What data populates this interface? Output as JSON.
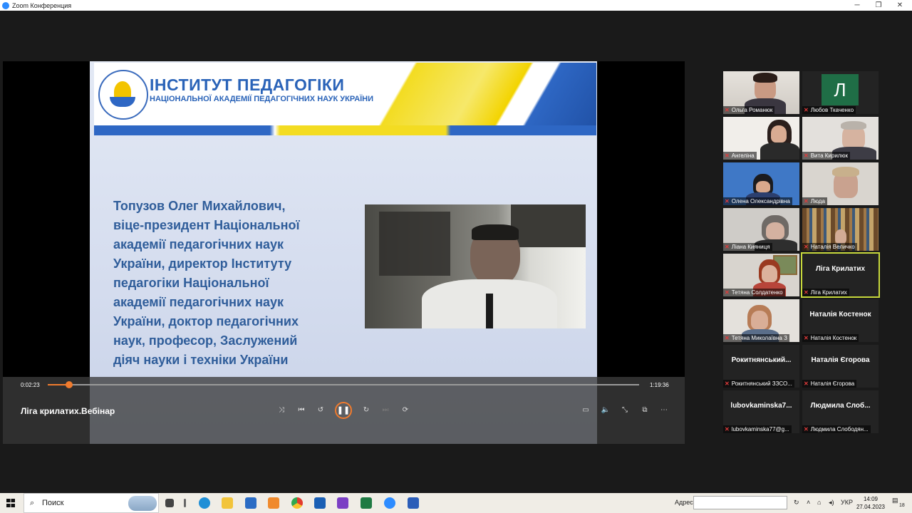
{
  "window": {
    "app_title": "Zoom Конференция"
  },
  "slide": {
    "institute_title": "ІНСТИТУТ ПЕДАГОГІКИ",
    "institute_subtitle": "НАЦІОНАЛЬНОЇ АКАДЕМІЇ ПЕДАГОГІЧНИХ НАУК УКРАЇНИ",
    "bio_lines": [
      "Топузов Олег Михайлович,",
      "віце-президент Національної",
      "академії педагогічних наук",
      "України, директор Інституту",
      "педагогіки Національної",
      "академії педагогічних наук",
      "України, доктор педагогічних",
      "наук, професор, Заслужений",
      "діяч науки і техніки України"
    ]
  },
  "player": {
    "current_time": "0:02:23",
    "total_time": "1:19:36",
    "progress_fraction": 0.036,
    "video_title": "Ліга крилатих.Вебінар",
    "accent_color": "#f07b2e"
  },
  "participants": [
    {
      "name": "Ольга Романюк",
      "type": "video"
    },
    {
      "name": "Любов Ткаченко",
      "type": "avatar",
      "initial": "Л"
    },
    {
      "name": "Ангеліна",
      "type": "video"
    },
    {
      "name": "Вита Кирилюк",
      "type": "video"
    },
    {
      "name": "Олена Олександрівна",
      "type": "video"
    },
    {
      "name": "Люда",
      "type": "video"
    },
    {
      "name": "Ліана Кияниця",
      "type": "video"
    },
    {
      "name": "Наталія Величко",
      "type": "video"
    },
    {
      "name": "Тетяна Солдатенко",
      "type": "video"
    },
    {
      "name": "Ліга Крилатих",
      "type": "name",
      "display": "Ліга Крилатих",
      "active": true
    },
    {
      "name": "Тетяна Миколаївна З",
      "type": "video"
    },
    {
      "name": "Наталія Костенок",
      "type": "name",
      "display": "Наталія Костенок"
    },
    {
      "name": "Рокитнянський ЗЗСО...",
      "type": "name",
      "display": "Рокитнянський..."
    },
    {
      "name": "Наталія Єгорова",
      "type": "name",
      "display": "Наталія Єгорова"
    },
    {
      "name": "lubovkaminska77@g...",
      "type": "name",
      "display": "lubovkaminska7..."
    },
    {
      "name": "Людмила Слободян...",
      "type": "name",
      "display": "Людмила Слоб..."
    }
  ],
  "taskbar": {
    "search_placeholder": "Поиск",
    "address_label": "Адрес",
    "language": "УКР",
    "time": "14:09",
    "date": "27.04.2023",
    "notifications": "18"
  }
}
